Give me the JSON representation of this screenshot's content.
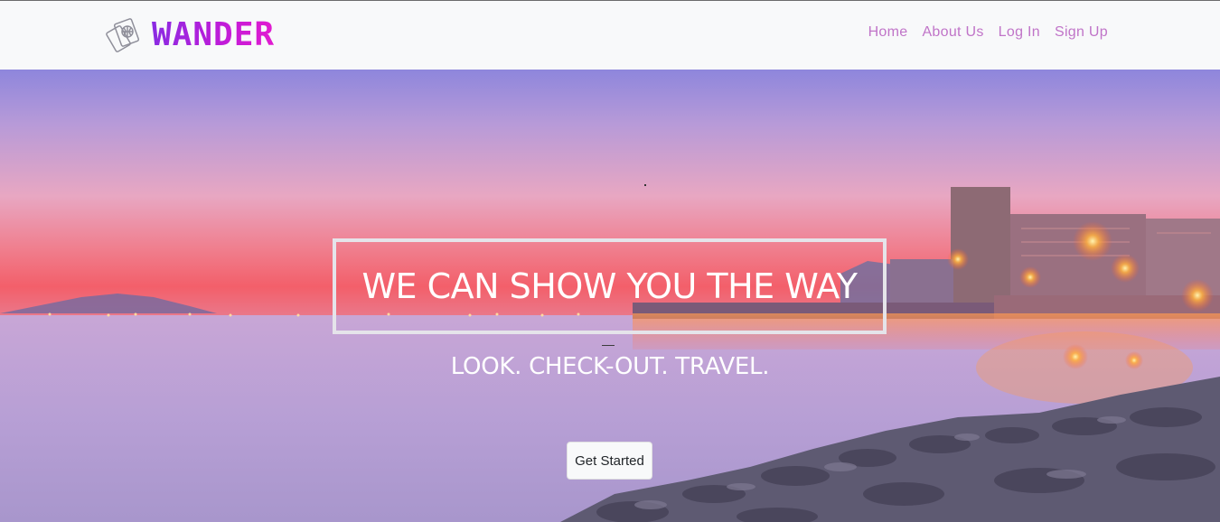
{
  "brand": {
    "name": "WANDER",
    "logo_icon": "passport-globe-icon"
  },
  "nav": {
    "items": [
      {
        "label": "Home"
      },
      {
        "label": "About Us"
      },
      {
        "label": "Log In"
      },
      {
        "label": "Sign Up"
      }
    ],
    "link_color": "#c074c8"
  },
  "hero": {
    "headline": "WE CAN SHOW YOU THE WAY",
    "tagline": "LOOK. CHECK-OUT. TRAVEL.",
    "cta_label": "Get Started"
  },
  "colors": {
    "brand_gradient_start": "#8a2be2",
    "brand_gradient_end": "#e21bd0",
    "navbar_bg": "#f8f9fa"
  }
}
